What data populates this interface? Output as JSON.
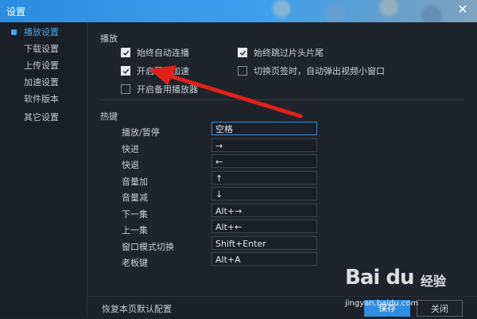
{
  "window": {
    "title": "设置",
    "close_icon": "close-icon",
    "accent": "#3ea5f2"
  },
  "sidebar": {
    "items": [
      {
        "label": "播放设置",
        "active": true
      },
      {
        "label": "下载设置",
        "active": false
      },
      {
        "label": "上传设置",
        "active": false
      },
      {
        "label": "加速设置",
        "active": false
      },
      {
        "label": "软件版本",
        "active": false
      },
      {
        "label": "其它设置",
        "active": false
      }
    ]
  },
  "playback": {
    "section_title": "播放",
    "options": [
      {
        "label": "始终自动连播",
        "checked": true
      },
      {
        "label": "始终跳过片头片尾",
        "checked": true
      },
      {
        "label": "开启硬件加速",
        "checked": true
      },
      {
        "label": "切换页签时，自动弹出视频小窗口",
        "checked": false
      },
      {
        "label": "开启备用播放器",
        "checked": false
      }
    ]
  },
  "hotkeys": {
    "section_title": "热键",
    "rows": [
      {
        "label": "播放/暂停",
        "value": "空格"
      },
      {
        "label": "快进",
        "value": "→"
      },
      {
        "label": "快退",
        "value": "←"
      },
      {
        "label": "音量加",
        "value": "↑"
      },
      {
        "label": "音量减",
        "value": "↓"
      },
      {
        "label": "下一集",
        "value": "Alt+→"
      },
      {
        "label": "上一集",
        "value": "Alt+←"
      },
      {
        "label": "窗口模式切换",
        "value": "Shift+Enter"
      },
      {
        "label": "老板键",
        "value": "Alt+A"
      }
    ]
  },
  "footer": {
    "reset_label": "恢复本页默认配置",
    "save_label": "保存",
    "close_label": "关闭"
  },
  "watermark": {
    "logo": "Bai du",
    "brand": "经验",
    "url": "jingyan.baidu.com"
  }
}
